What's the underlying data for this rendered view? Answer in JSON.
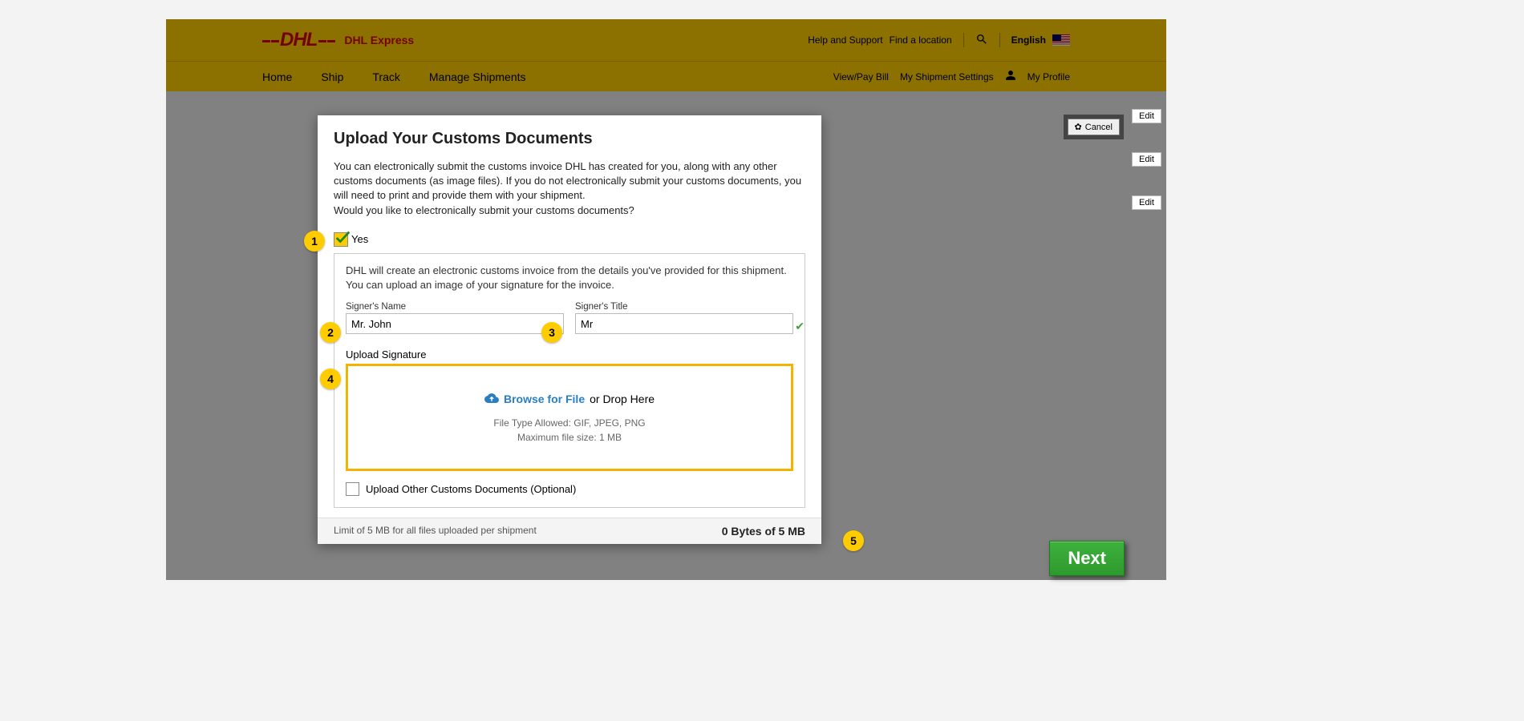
{
  "header": {
    "brand_text": "DHL Express",
    "help": "Help and Support",
    "find": "Find a location",
    "language": "English"
  },
  "nav": {
    "home": "Home",
    "ship": "Ship",
    "track": "Track",
    "manage": "Manage Shipments",
    "viewpay": "View/Pay Bill",
    "settings": "My Shipment Settings",
    "profile": "My Profile"
  },
  "bg": {
    "edit": "Edit",
    "cancel": "Cancel"
  },
  "modal": {
    "title": "Upload Your Customs Documents",
    "prose1": "You can electronically submit the customs invoice DHL has created for you, along with any other customs documents (as image files). If you do not electronically submit your customs documents, you will need to print and provide them with your shipment.",
    "prose2": "Would you like to electronically submit your customs documents?",
    "yes_label": "Yes",
    "panel_info": "DHL will create an electronic customs invoice from the details you've provided for this shipment. You can upload an image of your signature for the invoice.",
    "signer_name_label": "Signer's Name",
    "signer_name_value": "Mr. John",
    "signer_title_label": "Signer's Title",
    "signer_title_value": "Mr",
    "upload_label": "Upload Signature",
    "browse": "Browse for File",
    "or_drop": "or Drop Here",
    "file_type": "File Type Allowed: GIF, JPEG, PNG",
    "max_size": "Maximum file size: 1 MB",
    "opt_label": "Upload Other Customs Documents (Optional)",
    "footer_left": "Limit of 5 MB for all files uploaded per shipment",
    "footer_right": "0 Bytes of 5 MB"
  },
  "next": "Next",
  "callouts": {
    "c1": "1",
    "c2": "2",
    "c3": "3",
    "c4": "4",
    "c5": "5"
  }
}
